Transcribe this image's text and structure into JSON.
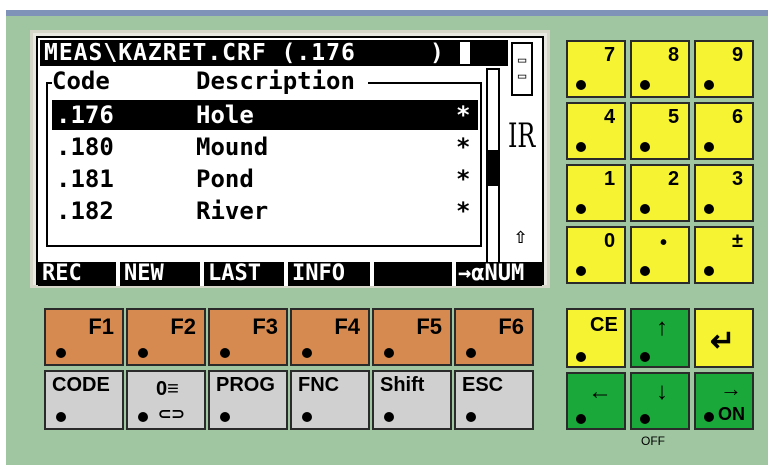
{
  "screen": {
    "title_path": "MEAS\\KAZRET.CRF (.176",
    "title_paren": ")",
    "battery_label": "IR",
    "header": {
      "code": "Code",
      "description": "Description"
    },
    "rows": [
      {
        "code": ".176",
        "description": "Hole",
        "flag": "*"
      },
      {
        "code": ".180",
        "description": "Mound",
        "flag": "*"
      },
      {
        "code": ".181",
        "description": "Pond",
        "flag": "*"
      },
      {
        "code": ".182",
        "description": "River",
        "flag": "*"
      }
    ],
    "softkeys": [
      "REC",
      "NEW",
      "LAST",
      "INFO",
      "",
      "→αNUM"
    ],
    "up_arrow": "⇧"
  },
  "numpad": [
    {
      "label": "7"
    },
    {
      "label": "8"
    },
    {
      "label": "9"
    },
    {
      "label": "4"
    },
    {
      "label": "5"
    },
    {
      "label": "6"
    },
    {
      "label": "1"
    },
    {
      "label": "2"
    },
    {
      "label": "3"
    },
    {
      "label": "0"
    },
    {
      "label": "•"
    },
    {
      "label": "±"
    }
  ],
  "function_keys": [
    "F1",
    "F2",
    "F3",
    "F4",
    "F5",
    "F6"
  ],
  "lower_keys": [
    "CODE",
    "",
    "PROG",
    "FNC",
    "Shift",
    "ESC"
  ],
  "nav_keys": {
    "ce": "CE",
    "up": "↑",
    "enter": "↵",
    "left": "←",
    "down": "↓",
    "right": "→",
    "on": "ON",
    "off": "OFF"
  },
  "colors": {
    "panel": "#9fc6a0",
    "numpad": "#f6f432",
    "fkey": "#d78a50",
    "gkey": "#d0d0d0",
    "nav_green": "#1aa83a"
  }
}
